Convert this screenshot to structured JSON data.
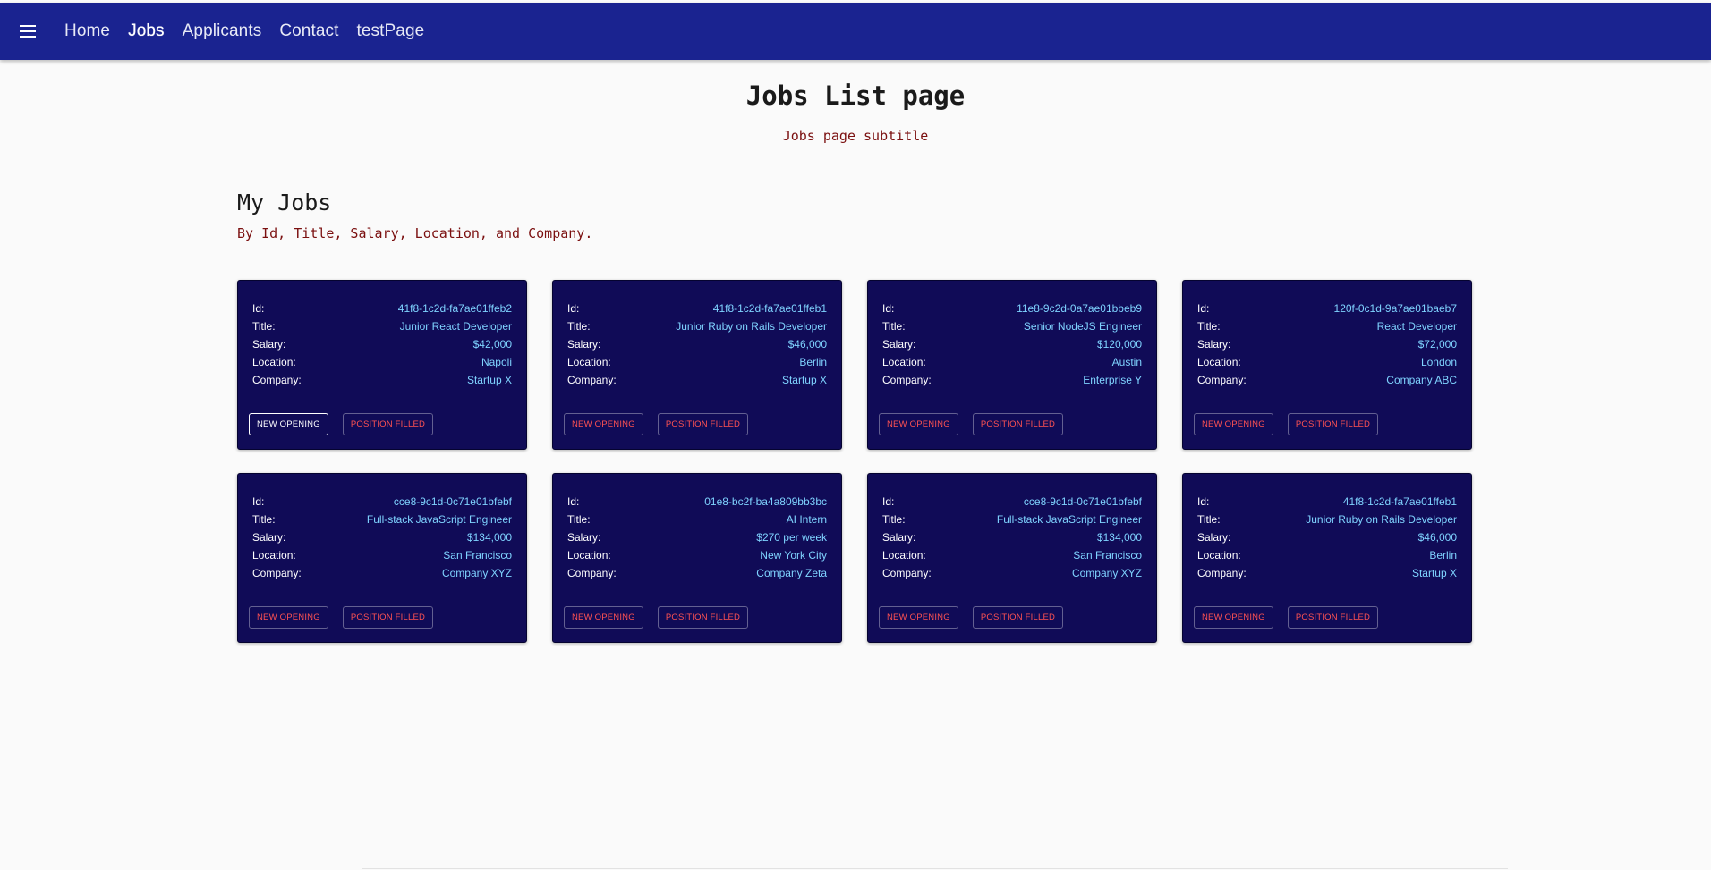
{
  "nav": {
    "links": [
      "Home",
      "Jobs",
      "Applicants",
      "Contact",
      "testPage"
    ],
    "active_index": 1,
    "bar_color": "#1a2390"
  },
  "header": {
    "title": "Jobs List page",
    "subtitle": "Jobs page subtitle"
  },
  "section": {
    "title": "My Jobs",
    "subtitle": "By Id, Title, Salary, Location, and Company."
  },
  "labels": {
    "id": "Id:",
    "title": "Title:",
    "salary": "Salary:",
    "location": "Location:",
    "company": "Company:",
    "new_opening": "NEW OPENING",
    "position_filled": "POSITION FILLED"
  },
  "jobs": [
    {
      "id": "41f8-1c2d-fa7ae01ffeb2",
      "title": "Junior React Developer",
      "salary": "$42,000",
      "location": "Napoli",
      "company": "Startup X"
    },
    {
      "id": "41f8-1c2d-fa7ae01ffeb1",
      "title": "Junior Ruby on Rails Developer",
      "salary": "$46,000",
      "location": "Berlin",
      "company": "Startup X"
    },
    {
      "id": "11e8-9c2d-0a7ae01bbeb9",
      "title": "Senior NodeJS Engineer",
      "salary": "$120,000",
      "location": "Austin",
      "company": "Enterprise Y"
    },
    {
      "id": "120f-0c1d-9a7ae01baeb7",
      "title": "React Developer",
      "salary": "$72,000",
      "location": "London",
      "company": "Company ABC"
    },
    {
      "id": "cce8-9c1d-0c71e01bfebf",
      "title": "Full-stack JavaScript Engineer",
      "salary": "$134,000",
      "location": "San Francisco",
      "company": "Company XYZ"
    },
    {
      "id": "01e8-bc2f-ba4a809bb3bc",
      "title": "AI Intern",
      "salary": "$270 per week",
      "location": "New York City",
      "company": "Company Zeta"
    },
    {
      "id": "cce8-9c1d-0c71e01bfebf",
      "title": "Full-stack JavaScript Engineer",
      "salary": "$134,000",
      "location": "San Francisco",
      "company": "Company XYZ"
    },
    {
      "id": "41f8-1c2d-fa7ae01ffeb1",
      "title": "Junior Ruby on Rails Developer",
      "salary": "$46,000",
      "location": "Berlin",
      "company": "Startup X"
    }
  ],
  "colors": {
    "card_bg": "#100b57",
    "value_text": "#7fd3ff",
    "accent_red": "#ff5252",
    "subtitle_text": "#7b1010"
  },
  "icons": {
    "menu": "hamburger-menu-icon"
  }
}
